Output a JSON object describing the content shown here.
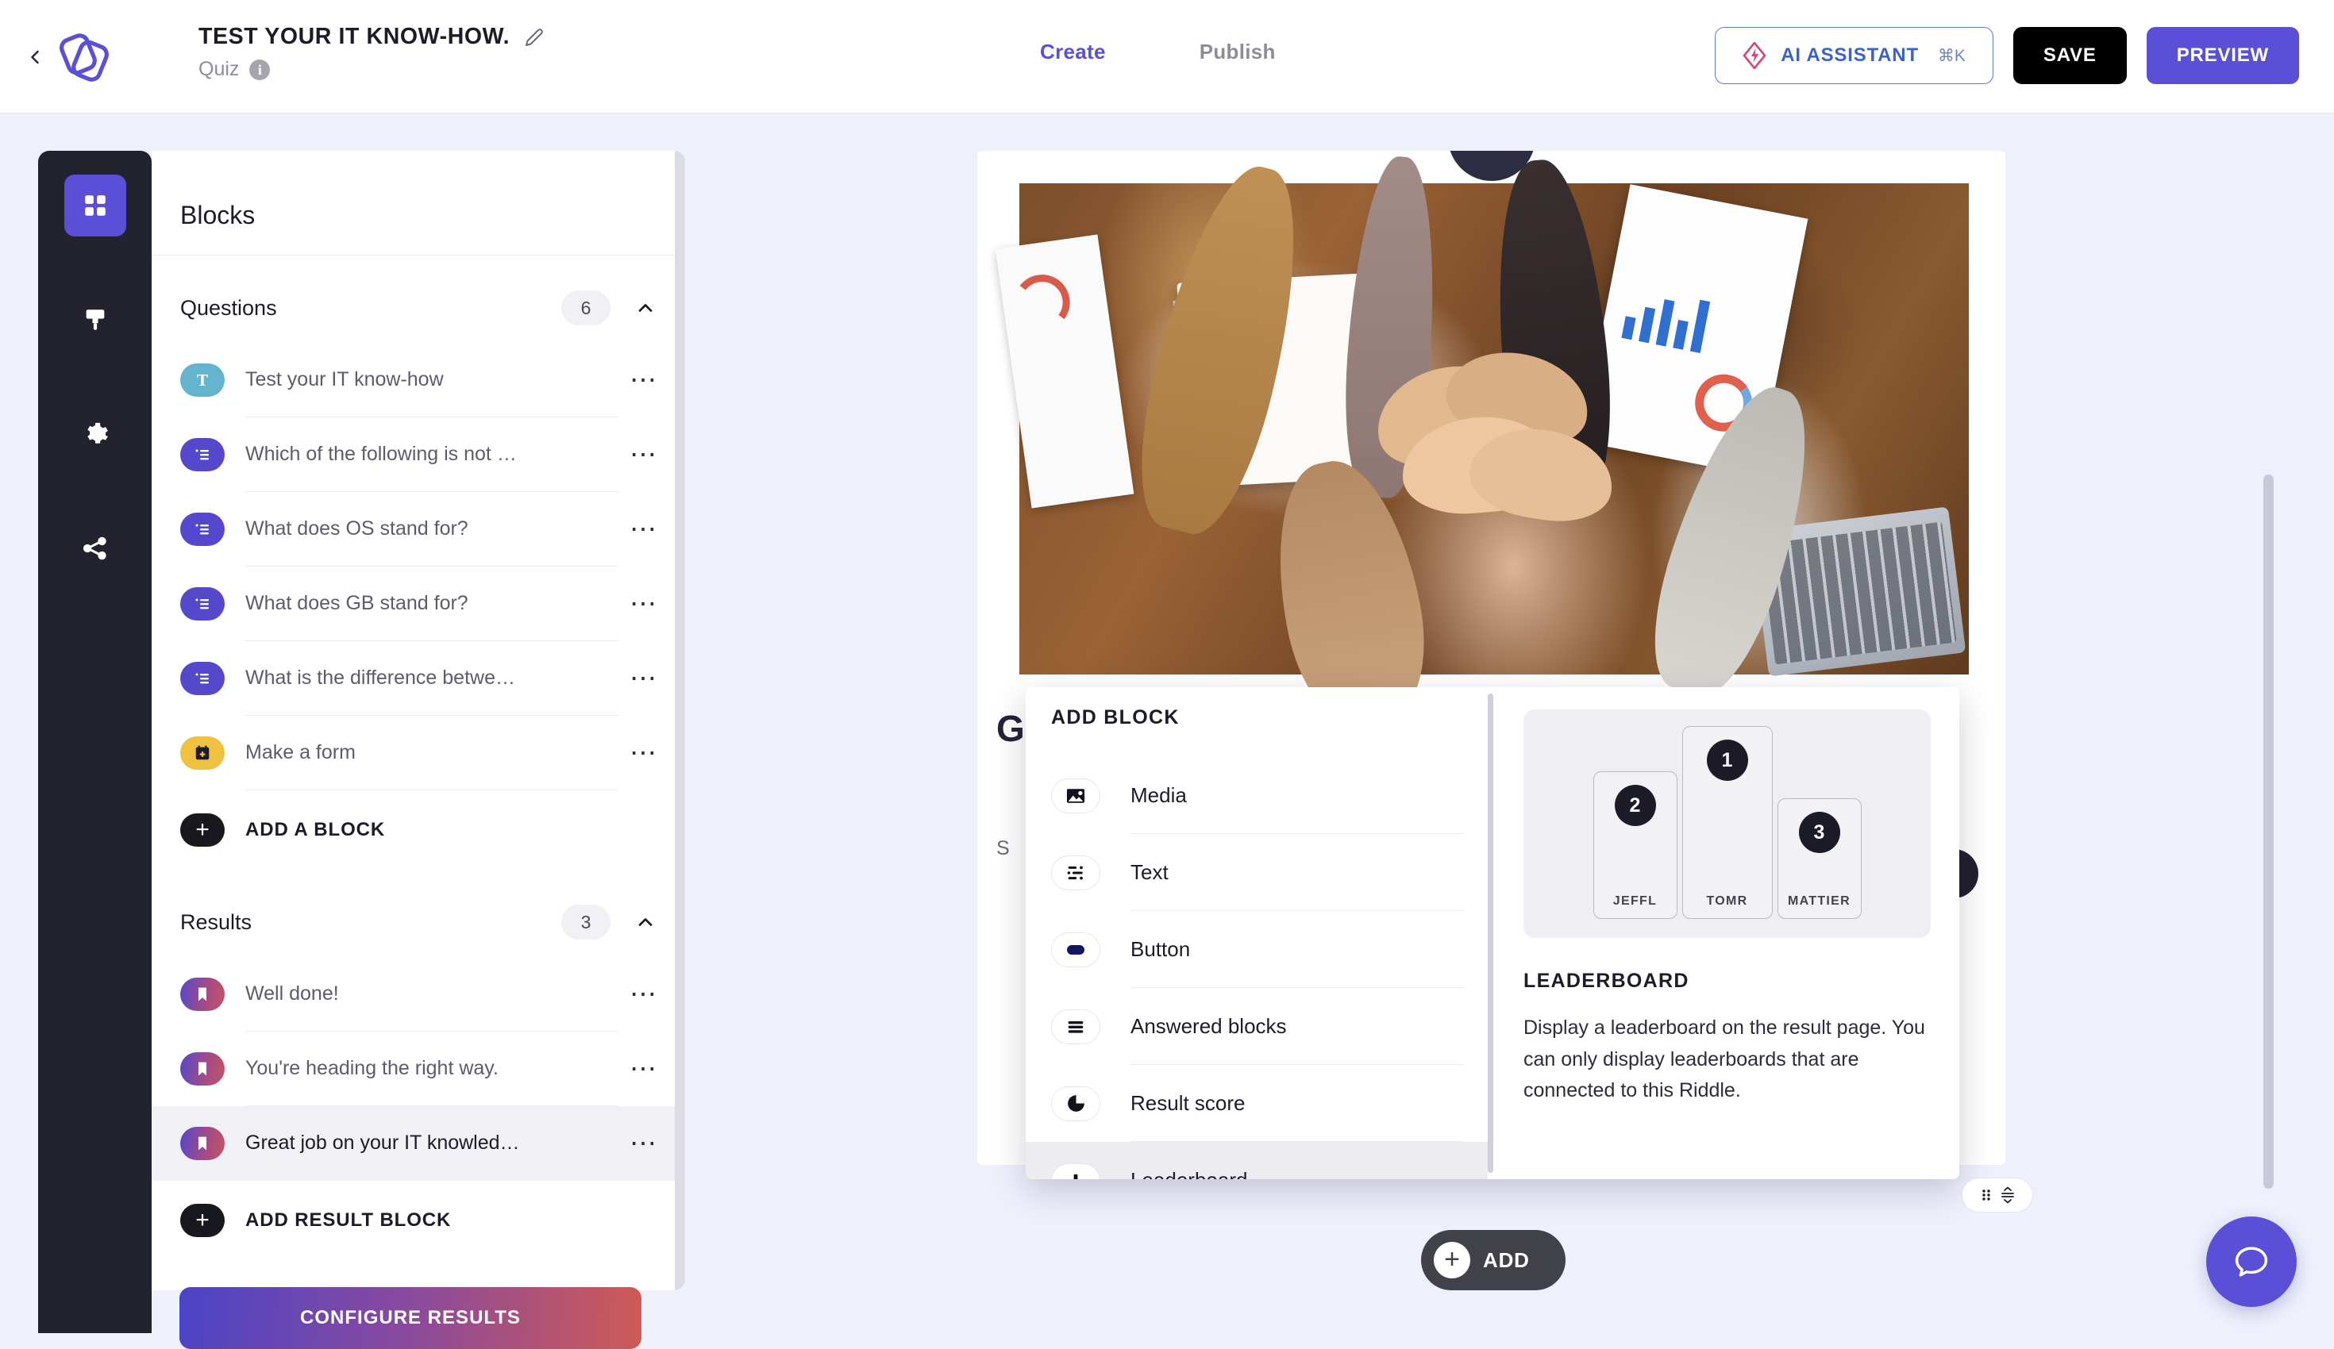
{
  "header": {
    "back_icon": "chevron-left-icon",
    "logo_icon": "riddle-logo",
    "title": "TEST YOUR IT KNOW-HOW.",
    "edit_icon": "pencil-icon",
    "subtype": "Quiz",
    "info_icon": "i",
    "tabs": [
      {
        "label": "Create",
        "active": true
      },
      {
        "label": "Publish",
        "active": false
      }
    ],
    "ai_button": {
      "label": "AI ASSISTANT",
      "shortcut": "⌘K",
      "icon": "ai-diamond-icon"
    },
    "save_label": "SAVE",
    "preview_label": "PREVIEW"
  },
  "rail": {
    "items": [
      {
        "icon": "grid-blocks-icon",
        "name": "blocks",
        "active": true
      },
      {
        "icon": "paintbrush-icon",
        "name": "design",
        "active": false
      },
      {
        "icon": "gear-icon",
        "name": "settings",
        "active": false
      },
      {
        "icon": "share-icon",
        "name": "share",
        "active": false
      }
    ]
  },
  "blocks_panel": {
    "title": "Blocks",
    "questions_section": {
      "title": "Questions",
      "count": "6",
      "collapse_icon": "chevron-up-icon",
      "items": [
        {
          "label": "Test your IT know-how",
          "chip": "chip-title",
          "chip_icon": "T",
          "selected": false
        },
        {
          "label": "Which of the following is not …",
          "chip": "chip-choice",
          "chip_icon": "list-icon",
          "selected": false
        },
        {
          "label": "What does OS stand for?",
          "chip": "chip-choice",
          "chip_icon": "list-icon",
          "selected": false
        },
        {
          "label": "What does GB stand for?",
          "chip": "chip-choice",
          "chip_icon": "list-icon",
          "selected": false
        },
        {
          "label": "What is the difference betwe…",
          "chip": "chip-choice",
          "chip_icon": "list-icon",
          "selected": false
        },
        {
          "label": "Make a form",
          "chip": "chip-form",
          "chip_icon": "form-icon",
          "selected": false
        }
      ],
      "add_label": "ADD A BLOCK"
    },
    "results_section": {
      "title": "Results",
      "count": "3",
      "collapse_icon": "chevron-up-icon",
      "items": [
        {
          "label": "Well done!",
          "chip": "chip-result",
          "chip_icon": "bookmark-icon",
          "selected": false
        },
        {
          "label": "You're heading the right way.",
          "chip": "chip-result",
          "chip_icon": "bookmark-icon",
          "selected": false
        },
        {
          "label": "Great job on your IT knowled…",
          "chip": "chip-result",
          "chip_icon": "bookmark-icon",
          "selected": true
        }
      ],
      "add_label": "ADD RESULT BLOCK"
    },
    "configure_label": "CONFIGURE RESULTS"
  },
  "canvas": {
    "photo_alt": "team-hands-stacked-photo",
    "heading_partial": "G",
    "subtext_partial": "S",
    "float_tool": {
      "drag_icon": "drag-handle-icon",
      "spacing_icon": "vertical-spacing-icon"
    },
    "add_fab_label": "ADD",
    "chat_icon": "chat-bubble-icon"
  },
  "add_block_modal": {
    "title": "ADD BLOCK",
    "items": [
      {
        "label": "Media",
        "icon": "image-icon",
        "highlighted": false
      },
      {
        "label": "Text",
        "icon": "text-lines-icon",
        "highlighted": false
      },
      {
        "label": "Button",
        "icon": "button-pill-icon",
        "highlighted": false
      },
      {
        "label": "Answered blocks",
        "icon": "hamburger-lines-icon",
        "highlighted": false
      },
      {
        "label": "Result score",
        "icon": "pie-chart-icon",
        "highlighted": false
      },
      {
        "label": "Leaderboard",
        "icon": "bar-chart-icon",
        "highlighted": true
      }
    ],
    "preview": {
      "title": "LEADERBOARD",
      "description": "Display a leaderboard on the result page. You can only display leaderboards that are connected to this Riddle.",
      "podium": [
        {
          "rank": "2",
          "name": "JEFFL",
          "height_class": "rank2"
        },
        {
          "rank": "1",
          "name": "TOMR",
          "height_class": "rank1"
        },
        {
          "rank": "3",
          "name": "MATTIER",
          "height_class": "rank3"
        }
      ]
    }
  },
  "colors": {
    "accent_purple": "#5a4fd6",
    "app_bg": "#eef0fc",
    "rail_dark": "#23232f",
    "chip_title": "#64b4ce",
    "chip_choice": "#5548cc",
    "chip_form": "#f0c040",
    "ai_pink": "#d6437f"
  }
}
